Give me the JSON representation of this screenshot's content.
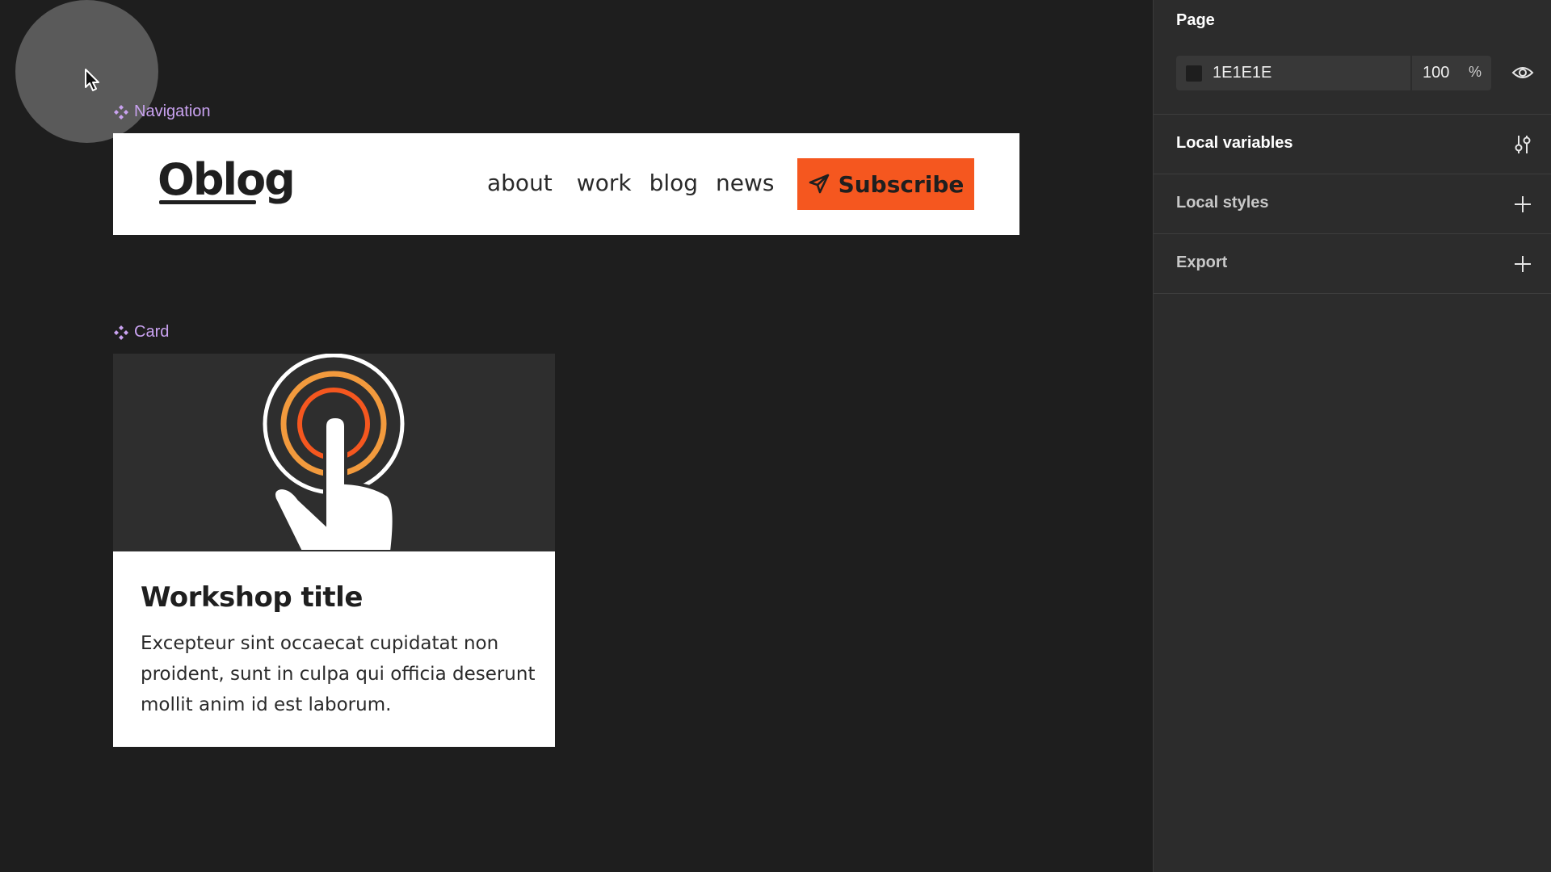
{
  "canvas": {
    "nav_component_label": "Navigation",
    "card_component_label": "Card",
    "navigation": {
      "logo": "Oblog",
      "links": [
        "about",
        "work",
        "blog",
        "news"
      ],
      "subscribe_label": "Subscribe",
      "accent_color": "#f5571f"
    },
    "card": {
      "title": "Workshop title",
      "body": "Excepteur sint occaecat cupidatat non proident, sunt in culpa qui officia deserunt mollit anim id est laborum."
    }
  },
  "panel": {
    "page_heading": "Page",
    "background_hex": "1E1E1E",
    "opacity": "100",
    "opacity_unit": "%",
    "sections": {
      "local_variables": "Local variables",
      "local_styles": "Local styles",
      "export": "Export"
    },
    "icons": {
      "visibility": "eye-icon",
      "variables": "sliders-icon",
      "add": "plus-icon"
    }
  }
}
